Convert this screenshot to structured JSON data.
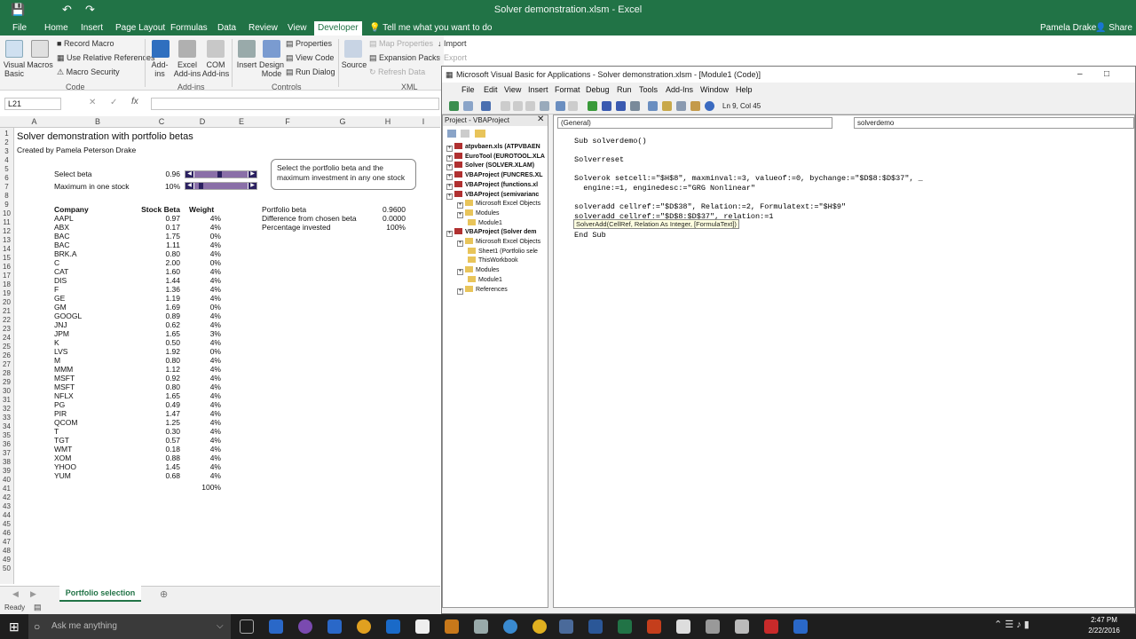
{
  "excel": {
    "window_title": "Solver demonstration.xlsm - Excel",
    "user": "Pamela Drake",
    "share_label": "Share",
    "tabs": [
      "File",
      "Home",
      "Insert",
      "Page Layout",
      "Formulas",
      "Data",
      "Review",
      "View",
      "Developer"
    ],
    "tell_me": "Tell me what you want to do",
    "ribbon": {
      "visual_basic": "Visual Basic",
      "macros": "Macros",
      "record_macro": "Record Macro",
      "use_relative": "Use Relative References",
      "macro_security": "Macro Security",
      "group_code": "Code",
      "addins": "Add-ins",
      "excel_addins": "Excel Add-ins",
      "com_addins": "COM Add-ins",
      "group_addins": "Add-ins",
      "insert": "Insert",
      "design_mode": "Design Mode",
      "properties": "Properties",
      "view_code": "View Code",
      "run_dialog": "Run Dialog",
      "group_controls": "Controls",
      "source": "Source",
      "map_properties": "Map Properties",
      "expansion_packs": "Expansion Packs",
      "refresh_data": "Refresh Data",
      "import": "Import",
      "export": "Export",
      "group_xml": "XML"
    },
    "name_box": "L21",
    "columns": [
      "A",
      "B",
      "C",
      "D",
      "E",
      "F",
      "G",
      "H",
      "I"
    ],
    "rows": [
      "1",
      "2",
      "3",
      "4",
      "5",
      "6",
      "7",
      "8",
      "9",
      "10",
      "11",
      "12",
      "13",
      "14",
      "15",
      "16",
      "17",
      "18",
      "19",
      "20",
      "21",
      "22",
      "23",
      "24",
      "25",
      "26",
      "27",
      "28",
      "29",
      "30",
      "31",
      "32",
      "33",
      "34",
      "35",
      "36",
      "37",
      "38",
      "39",
      "40",
      "41",
      "42",
      "43",
      "44",
      "45",
      "46",
      "47",
      "48",
      "49",
      "50"
    ],
    "sheet": {
      "title": "Solver demonstration with portfolio betas",
      "author": "Created by Pamela Peterson Drake",
      "select_beta_label": "Select beta",
      "select_beta_value": "0.96",
      "max_stock_label": "Maximum in one stock",
      "max_stock_value": "10%",
      "callout": "Select the portfolio beta and the maximum investment in any one stock",
      "hdr_company": "Company",
      "hdr_beta": "Stock Beta",
      "hdr_weight": "Weight",
      "portfolio_beta_label": "Portfolio beta",
      "portfolio_beta_value": "0.9600",
      "diff_label": "Difference from chosen beta",
      "diff_value": "0.0000",
      "pct_label": "Percentage invested",
      "pct_value": "100%",
      "total_weight": "100%",
      "stocks": [
        {
          "c": "AAPL",
          "b": "0.97",
          "w": "4%"
        },
        {
          "c": "ABX",
          "b": "0.17",
          "w": "4%"
        },
        {
          "c": "BAC",
          "b": "1.75",
          "w": "0%"
        },
        {
          "c": "BAC",
          "b": "1.11",
          "w": "4%"
        },
        {
          "c": "BRK.A",
          "b": "0.80",
          "w": "4%"
        },
        {
          "c": "C",
          "b": "2.00",
          "w": "0%"
        },
        {
          "c": "CAT",
          "b": "1.60",
          "w": "4%"
        },
        {
          "c": "DIS",
          "b": "1.44",
          "w": "4%"
        },
        {
          "c": "F",
          "b": "1.36",
          "w": "4%"
        },
        {
          "c": "GE",
          "b": "1.19",
          "w": "4%"
        },
        {
          "c": "GM",
          "b": "1.69",
          "w": "0%"
        },
        {
          "c": "GOOGL",
          "b": "0.89",
          "w": "4%"
        },
        {
          "c": "JNJ",
          "b": "0.62",
          "w": "4%"
        },
        {
          "c": "JPM",
          "b": "1.65",
          "w": "3%"
        },
        {
          "c": "K",
          "b": "0.50",
          "w": "4%"
        },
        {
          "c": "LVS",
          "b": "1.92",
          "w": "0%"
        },
        {
          "c": "M",
          "b": "0.80",
          "w": "4%"
        },
        {
          "c": "MMM",
          "b": "1.12",
          "w": "4%"
        },
        {
          "c": "MSFT",
          "b": "0.92",
          "w": "4%"
        },
        {
          "c": "MSFT",
          "b": "0.80",
          "w": "4%"
        },
        {
          "c": "NFLX",
          "b": "1.65",
          "w": "4%"
        },
        {
          "c": "PG",
          "b": "0.49",
          "w": "4%"
        },
        {
          "c": "PIR",
          "b": "1.47",
          "w": "4%"
        },
        {
          "c": "QCOM",
          "b": "1.25",
          "w": "4%"
        },
        {
          "c": "T",
          "b": "0.30",
          "w": "4%"
        },
        {
          "c": "TGT",
          "b": "0.57",
          "w": "4%"
        },
        {
          "c": "WMT",
          "b": "0.18",
          "w": "4%"
        },
        {
          "c": "XOM",
          "b": "0.88",
          "w": "4%"
        },
        {
          "c": "YHOO",
          "b": "1.45",
          "w": "4%"
        },
        {
          "c": "YUM",
          "b": "0.68",
          "w": "4%"
        }
      ]
    },
    "sheet_tab": "Portfolio selection",
    "status": "Ready"
  },
  "vba": {
    "title": "Microsoft Visual Basic for Applications - Solver demonstration.xlsm - [Module1 (Code)]",
    "menus": [
      "File",
      "Edit",
      "View",
      "Insert",
      "Format",
      "Debug",
      "Run",
      "Tools",
      "Add-Ins",
      "Window",
      "Help"
    ],
    "cursor_pos": "Ln 9, Col 45",
    "project_title": "Project - VBAProject",
    "tree": [
      {
        "t": "atpvbaen.xls (ATPVBAEN",
        "bold": true,
        "lvl": 0
      },
      {
        "t": "EuroTool (EUROTOOL.XLA",
        "bold": true,
        "lvl": 0
      },
      {
        "t": "Solver (SOLVER.XLAM)",
        "bold": true,
        "lvl": 0
      },
      {
        "t": "VBAProject (FUNCRES.XL",
        "bold": true,
        "lvl": 0
      },
      {
        "t": "VBAProject (functions.xl",
        "bold": true,
        "lvl": 0
      },
      {
        "t": "VBAProject (semivarianc",
        "bold": true,
        "lvl": 0
      },
      {
        "t": "Microsoft Excel Objects",
        "bold": false,
        "lvl": 1
      },
      {
        "t": "Modules",
        "bold": false,
        "lvl": 1
      },
      {
        "t": "Module1",
        "bold": false,
        "lvl": 2
      },
      {
        "t": "VBAProject (Solver dem",
        "bold": true,
        "lvl": 0
      },
      {
        "t": "Microsoft Excel Objects",
        "bold": false,
        "lvl": 1
      },
      {
        "t": "Sheet1 (Portfolio sele",
        "bold": false,
        "lvl": 2
      },
      {
        "t": "ThisWorkbook",
        "bold": false,
        "lvl": 2
      },
      {
        "t": "Modules",
        "bold": false,
        "lvl": 1
      },
      {
        "t": "Module1",
        "bold": false,
        "lvl": 2
      },
      {
        "t": "References",
        "bold": false,
        "lvl": 1
      }
    ],
    "object_dropdown": "(General)",
    "proc_dropdown": "solverdemo",
    "code": [
      "Sub solverdemo()",
      "",
      "Solverreset",
      "",
      "Solverok setcell:=\"$H$8\", maxminval:=3, valueof:=0, bychange:=\"$D$8:$D$37\", _",
      "  engine:=1, enginedesc:=\"GRG Nonlinear\"",
      "",
      "solveradd cellref:=\"$D$38\", Relation:=2, Formulatext:=\"$H$9\"",
      "solveradd cellref:=\"$D$8:$D$37\", relation:=1",
      "",
      "End Sub"
    ],
    "tooltip": "SolverAdd(CellRef, Relation As Integer, [FormulaText])"
  },
  "taskbar": {
    "search": "Ask me anything",
    "time": "2:47 PM",
    "date": "2/22/2016"
  },
  "colors": {
    "excel_green": "#217346",
    "slider": "#8a6fa8"
  }
}
